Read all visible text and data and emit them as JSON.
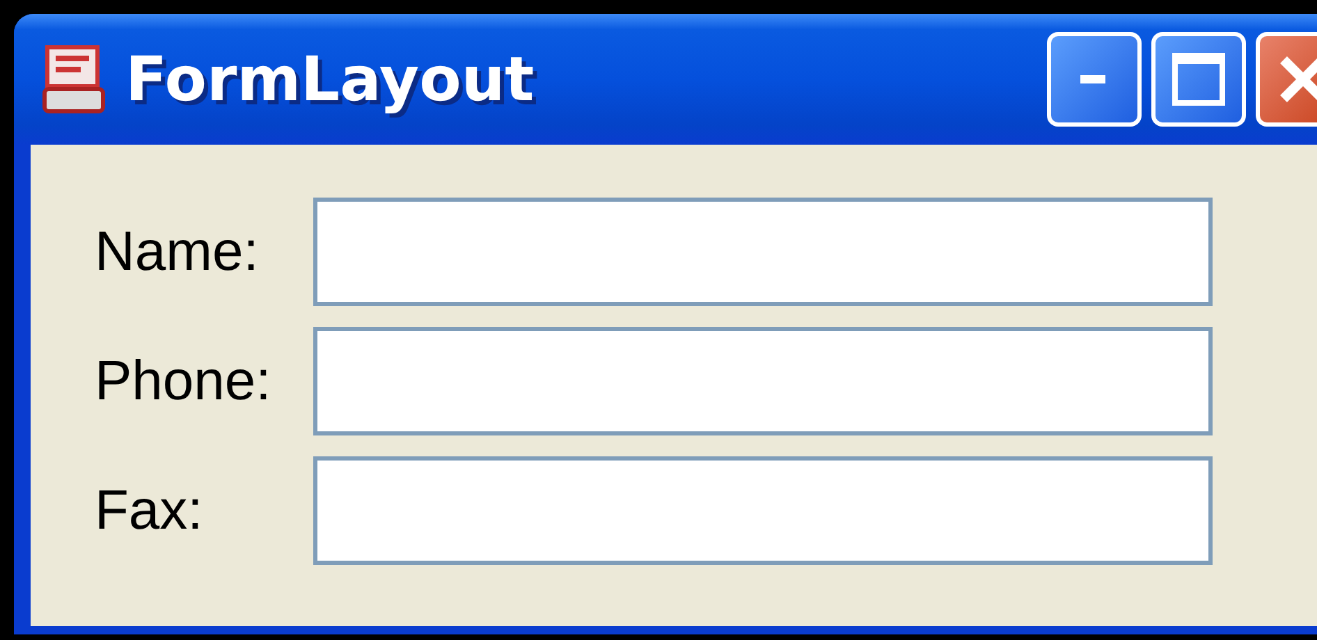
{
  "window": {
    "title": "FormLayout"
  },
  "fields": [
    {
      "label": "Name:"
    },
    {
      "label": "Phone:"
    },
    {
      "label": "Fax:"
    }
  ]
}
